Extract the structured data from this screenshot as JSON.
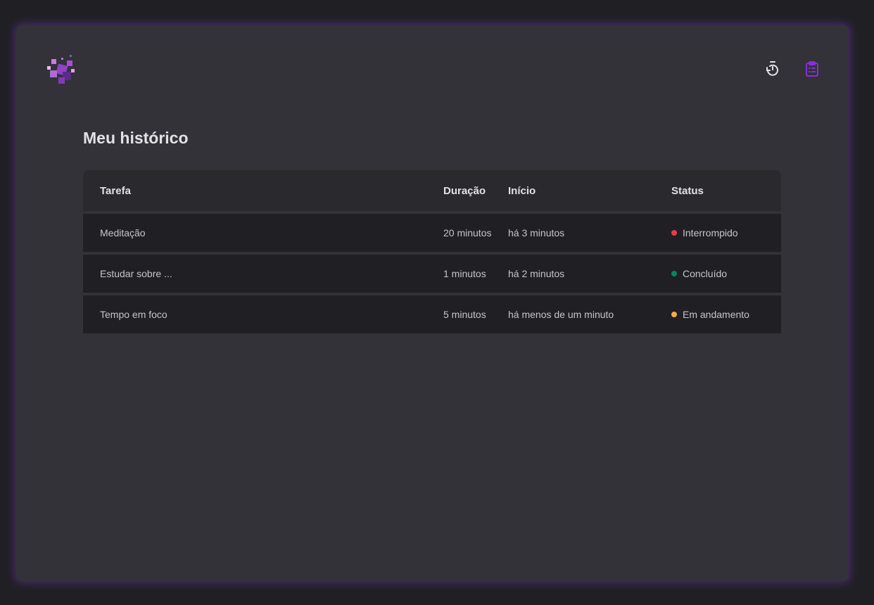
{
  "header": {
    "nav": [
      {
        "name": "timer",
        "active": false
      },
      {
        "name": "history",
        "active": true
      }
    ]
  },
  "page": {
    "title": "Meu histórico"
  },
  "table": {
    "columns": [
      "Tarefa",
      "Duração",
      "Início",
      "Status"
    ],
    "rows": [
      {
        "task": "Meditação",
        "duration": "20 minutos",
        "start": "há 3 minutos",
        "status": "Interrompido",
        "color": "#f03847"
      },
      {
        "task": "Estudar sobre ...",
        "duration": "1 minutos",
        "start": "há 2 minutos",
        "status": "Concluído",
        "color": "#00875f"
      },
      {
        "task": "Tempo em foco",
        "duration": "5 minutos",
        "start": "há menos de um minuto",
        "status": "Em andamento",
        "color": "#fba94c"
      }
    ]
  },
  "colors": {
    "accent": "#8257e5",
    "active_icon": "#8a2be2"
  }
}
